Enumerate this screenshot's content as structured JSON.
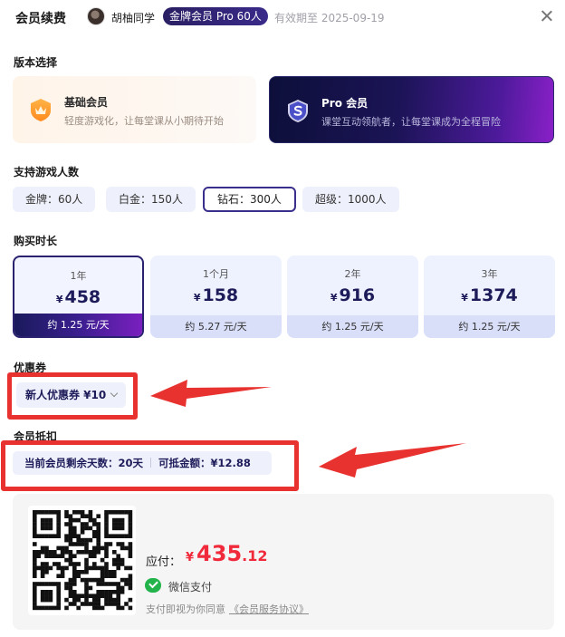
{
  "header": {
    "title": "会员续费",
    "username": "胡柚同学",
    "member_badge": "金牌会员 Pro 60人",
    "expiry": "有效期至 2025-09-19",
    "close_icon": "close-icon"
  },
  "version_section": {
    "label": "版本选择",
    "options": [
      {
        "name": "基础会员",
        "desc": "轻度游戏化，让每堂课从小期待开始",
        "icon": "shield-badge-icon",
        "selected": false
      },
      {
        "name": "Pro 会员",
        "desc": "课堂互动领航者，让每堂课成为全程冒险",
        "icon": "shield-s-icon",
        "selected": true
      }
    ]
  },
  "players_section": {
    "label": "支持游戏人数",
    "options": [
      {
        "label": "金牌：60人",
        "selected": false
      },
      {
        "label": "白金：150人",
        "selected": false
      },
      {
        "label": "钻石：300人",
        "selected": true
      },
      {
        "label": "超级：1000人",
        "selected": false
      }
    ]
  },
  "duration_section": {
    "label": "购买时长",
    "options": [
      {
        "label": "1年",
        "currency": "¥",
        "price": "458",
        "unit_price": "约 1.25 元/天",
        "selected": true
      },
      {
        "label": "1个月",
        "currency": "¥",
        "price": "158",
        "unit_price": "约 5.27 元/天",
        "selected": false
      },
      {
        "label": "2年",
        "currency": "¥",
        "price": "916",
        "unit_price": "约 1.25 元/天",
        "selected": false
      },
      {
        "label": "3年",
        "currency": "¥",
        "price": "1374",
        "unit_price": "约 1.25 元/天",
        "selected": false
      }
    ]
  },
  "coupon_section": {
    "label": "优惠券",
    "selected": "新人优惠券 ¥10"
  },
  "deduct_section": {
    "label": "会员抵扣",
    "remaining_days": "当前会员剩余天数：20天",
    "deductible": "可抵金额：¥12.88"
  },
  "payment": {
    "amount_label": "应付：",
    "currency": "¥",
    "amount_int": "435",
    "amount_dec": ".12",
    "method": "微信支付",
    "method_icon": "wechat-pay-icon",
    "agreement_prefix": "支付即视为你同意",
    "agreement_link": "《会员服务协议》"
  },
  "colors": {
    "accent_dark": "#1d1b59",
    "price_red": "#f02a3a",
    "annotation_red": "#e8322f",
    "wechat_green": "#22b34a"
  }
}
